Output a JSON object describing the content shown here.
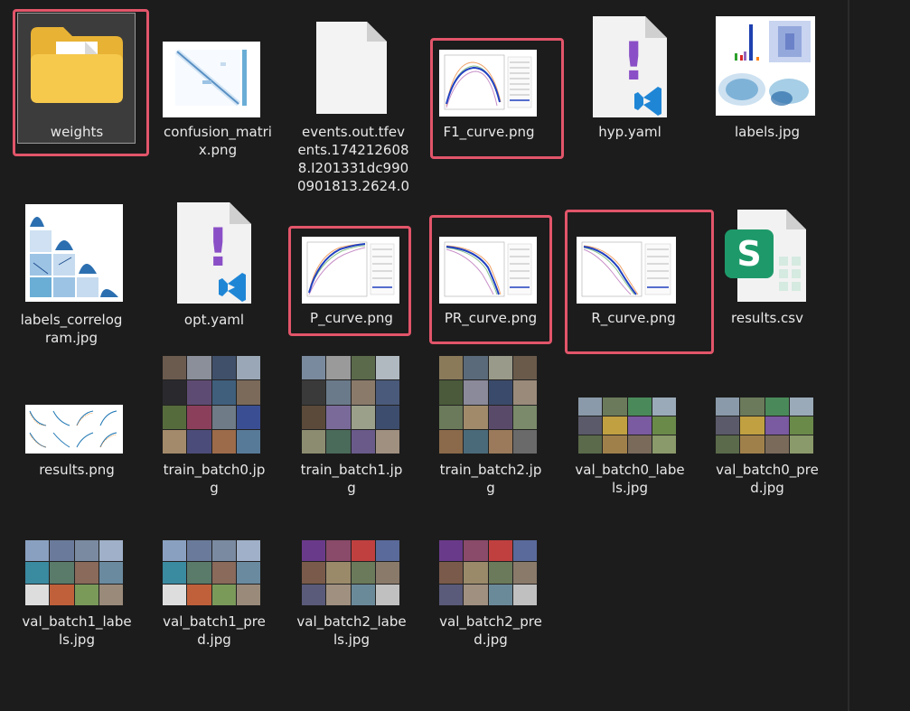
{
  "files": [
    {
      "name": "weights",
      "kind": "folder",
      "selected": true,
      "highlighted": true
    },
    {
      "name": "confusion_matrix.png",
      "kind": "image-matrix"
    },
    {
      "name": "events.out.tfevents.1742126088.I201331dc9900901813.2624.0",
      "kind": "blank-file"
    },
    {
      "name": "F1_curve.png",
      "kind": "image-curve",
      "highlighted": true
    },
    {
      "name": "hyp.yaml",
      "kind": "yaml"
    },
    {
      "name": "labels.jpg",
      "kind": "image-labels"
    },
    {
      "name": "labels_correlogram.jpg",
      "kind": "image-correlogram"
    },
    {
      "name": "opt.yaml",
      "kind": "yaml"
    },
    {
      "name": "P_curve.png",
      "kind": "image-curve",
      "highlighted": true
    },
    {
      "name": "PR_curve.png",
      "kind": "image-curve",
      "highlighted": true
    },
    {
      "name": "R_curve.png",
      "kind": "image-curve",
      "highlighted": true
    },
    {
      "name": "results.csv",
      "kind": "csv"
    },
    {
      "name": "results.png",
      "kind": "image-results"
    },
    {
      "name": "train_batch0.jpg",
      "kind": "image-mosaic"
    },
    {
      "name": "train_batch1.jpg",
      "kind": "image-mosaic"
    },
    {
      "name": "train_batch2.jpg",
      "kind": "image-mosaic"
    },
    {
      "name": "val_batch0_labels.jpg",
      "kind": "image-mosaic-wide"
    },
    {
      "name": "val_batch0_pred.jpg",
      "kind": "image-mosaic-wide"
    },
    {
      "name": "val_batch1_labels.jpg",
      "kind": "image-mosaic-wide"
    },
    {
      "name": "val_batch1_pred.jpg",
      "kind": "image-mosaic-wide"
    },
    {
      "name": "val_batch2_labels.jpg",
      "kind": "image-mosaic-wide"
    },
    {
      "name": "val_batch2_pred.jpg",
      "kind": "image-mosaic-wide"
    }
  ],
  "labels": {
    "weights": "weights",
    "confusion_matrix": "confusion_matri\nx.png",
    "events": "events.out.tfev\nents.174212608\n8.I201331dc990\n0901813.2624.0",
    "f1_curve": "F1_curve.png",
    "hyp": "hyp.yaml",
    "labels_jpg": "labels.jpg",
    "labels_correlogram": "labels_correlog\nram.jpg",
    "opt": "opt.yaml",
    "p_curve": "P_curve.png",
    "pr_curve": "PR_curve.png",
    "r_curve": "R_curve.png",
    "results_csv": "results.csv",
    "results_png": "results.png",
    "train_batch0": "train_batch0.jp\ng",
    "train_batch1": "train_batch1.jp\ng",
    "train_batch2": "train_batch2.jp\ng",
    "val_batch0_labels": "val_batch0_labe\nls.jpg",
    "val_batch0_pred": "val_batch0_pre\nd.jpg",
    "val_batch1_labels": "val_batch1_labe\nls.jpg",
    "val_batch1_pred": "val_batch1_pre\nd.jpg",
    "val_batch2_labels": "val_batch2_labe\nls.jpg",
    "val_batch2_pred": "val_batch2_pre\nd.jpg"
  },
  "colors": {
    "background": "#1c1c1c",
    "highlight": "#e2556a",
    "folder": "#f4c64a",
    "yaml_mark": "#8a4fc6",
    "vscode_blue": "#1f86d6",
    "csv_green": "#1e9a6a"
  },
  "icons": {
    "folder": "folder-icon",
    "yaml": "yaml-file-icon",
    "blank": "blank-file-icon",
    "csv": "csv-spreadsheet-icon"
  },
  "glyphs": {
    "yaml_mark": "!",
    "csv_letter": "S"
  }
}
